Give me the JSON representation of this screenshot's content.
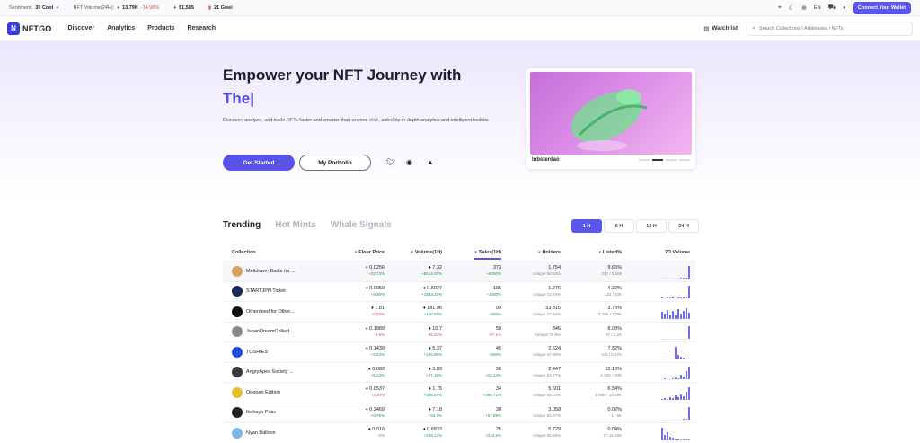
{
  "topbar": {
    "sentiment_label": "Sentiment:",
    "sentiment_value": "30 Cool",
    "volume_label": "NFT Volume(24H):",
    "volume_value": "13.79K",
    "volume_change": "-14.98%",
    "eth_price": "$1,585",
    "gas": "21 Gwei",
    "lang": "EN",
    "connect_label": "Connect Your Wallet"
  },
  "nav": {
    "logo": "NFTGO",
    "items": [
      "Discover",
      "Analytics",
      "Products",
      "Research"
    ],
    "watchlist": "Watchlist",
    "search_placeholder": "Search Collections / Addresses / NFTs"
  },
  "hero": {
    "title": "Empower your NFT Journey with",
    "typed": "The|",
    "description": "Discover, analyze, and trade NFTs faster and smarter than anyone else, aided by in-depth analytics and intelligent toolkits",
    "start_label": "Get Started",
    "portfolio_label": "My Portfolio",
    "featured_name": "lobsterdao"
  },
  "tabs": [
    "Trending",
    "Hot Mints",
    "Whale Signals"
  ],
  "timeframes": [
    "1 H",
    "6 H",
    "12 H",
    "24 H"
  ],
  "table": {
    "headers": [
      "Collection",
      "Floor Price",
      "Volume(1H)",
      "Sales(1H)",
      "Holders",
      "Listed%",
      "7D Volume"
    ],
    "rows": [
      {
        "name": "Meltdown: Battle for ...",
        "floor": "0.0256",
        "floor_chg": "+22.73%",
        "vol": "7.32",
        "vol_chg": "+8014.07%",
        "sales": "373",
        "sales_chg": "+9250%",
        "holders": "1,754",
        "unique": "Unique 68.53%",
        "listed": "9.65%",
        "listed_sub": "247 / 2,559",
        "color": "#d9a35c",
        "bars": [
          0,
          0,
          0,
          0,
          0,
          0,
          0,
          1,
          1,
          1,
          14
        ]
      },
      {
        "name": "STARTJPN Ticket",
        "floor": "0.0059",
        "floor_chg": "+5.36%",
        "vol": "0.6027",
        "vol_chg": "+1503.22%",
        "sales": "105",
        "sales_chg": "+1400%",
        "holders": "1,276",
        "unique": "Unique 12.76%",
        "listed": "4.22%",
        "listed_sub": "422 / 10K",
        "color": "#1b2b55",
        "bars": [
          1,
          0,
          1,
          1,
          2,
          0,
          1,
          1,
          1,
          2,
          14
        ]
      },
      {
        "name": "Otherdeed for Other...",
        "floor": "1.81",
        "floor_chg": "-0.63%",
        "vol": "181.96",
        "vol_chg": "+166.59%",
        "sales": "99",
        "sales_chg": "+300%",
        "holders": "33,315",
        "unique": "Unique 33.32%",
        "listed": "3.78%",
        "listed_sub": "3,78K / 100K",
        "color": "#111111",
        "bars": [
          8,
          6,
          10,
          5,
          9,
          4,
          11,
          6,
          9,
          12,
          7
        ]
      },
      {
        "name": "JapanDreamCollect...",
        "floor": "0.1989",
        "floor_chg": "-0.6%",
        "vol": "10.7",
        "vol_chg": "-65.32%",
        "sales": "50",
        "sales_chg": "-97.1%",
        "holders": "846",
        "unique": "Unique 70.5%",
        "listed": "8.08%",
        "listed_sub": "97 / 1.2K",
        "color": "#8a8a8a",
        "bars": [
          0,
          0,
          0,
          0,
          0,
          0,
          0,
          0,
          0,
          0,
          14
        ]
      },
      {
        "name": "TOSHIES",
        "floor": "0.1439",
        "floor_chg": "+3.53%",
        "vol": "5.37",
        "vol_chg": "+145.99%",
        "sales": "45",
        "sales_chg": "+200%",
        "holders": "2,624",
        "unique": "Unique 47.98%",
        "listed": "7.52%",
        "listed_sub": "411 / 5.47K",
        "color": "#1f4bd6",
        "bars": [
          0,
          0,
          0,
          0,
          0,
          14,
          5,
          3,
          2,
          1,
          1
        ]
      },
      {
        "name": "AngryApes Society ...",
        "floor": "0.082",
        "floor_chg": "+5.13%",
        "vol": "3.83",
        "vol_chg": "+47.46%",
        "sales": "36",
        "sales_chg": "+24.14%",
        "holders": "2,447",
        "unique": "Unique 24.47%",
        "listed": "12.18%",
        "listed_sub": "1.22K / 10K",
        "color": "#3a3a3a",
        "bars": [
          0,
          1,
          0,
          0,
          1,
          2,
          1,
          5,
          3,
          9,
          14
        ]
      },
      {
        "name": "Opepen Edition",
        "floor": "0.0537",
        "floor_chg": "-2.36%",
        "vol": "1.75",
        "vol_chg": "+348.54%",
        "sales": "34",
        "sales_chg": "+385.71%",
        "holders": "5,601",
        "unique": "Unique 35.04%",
        "listed": "6.54%",
        "listed_sub": "1.05K / 15.99K",
        "color": "#e0c030",
        "bars": [
          1,
          2,
          1,
          3,
          2,
          5,
          3,
          6,
          4,
          9,
          14
        ]
      },
      {
        "name": "Ikehaya Pass",
        "floor": "0.2469",
        "floor_chg": "+0.76%",
        "vol": "7.18",
        "vol_chg": "+93.3%",
        "sales": "30",
        "sales_chg": "+57.89%",
        "holders": "3,058",
        "unique": "Unique 50.97%",
        "listed": "0.02%",
        "listed_sub": "1 / 6K",
        "color": "#222222",
        "bars": [
          0,
          0,
          0,
          0,
          0,
          0,
          0,
          0,
          1,
          1,
          14
        ]
      },
      {
        "name": "Nyan Balloon",
        "floor": "0.016",
        "floor_chg": "0%",
        "vol": "0.6833",
        "vol_chg": "+249.13%",
        "sales": "25",
        "sales_chg": "+212.5%",
        "holders": "5,729",
        "unique": "Unique 36.58%",
        "listed": "0.04%",
        "listed_sub": "7 / 15.66K",
        "color": "#7ab8e8",
        "bars": [
          14,
          6,
          9,
          4,
          3,
          2,
          2,
          1,
          1,
          1,
          1
        ]
      }
    ]
  }
}
